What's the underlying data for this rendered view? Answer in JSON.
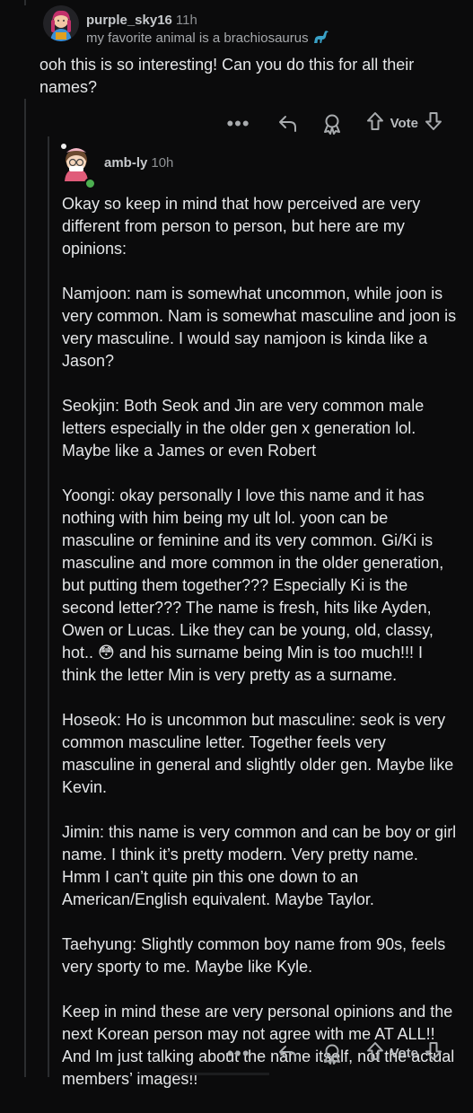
{
  "parent": {
    "username": "purple_sky16",
    "time": "11h",
    "flair": "my favorite animal is a brachiosaurus",
    "body": "ooh this is so interesting! Can you do this for all their names?"
  },
  "actions": {
    "vote_label": "Vote"
  },
  "reply": {
    "username": "amb-ly",
    "time": "10h",
    "paragraphs": [
      "Okay so keep in mind that how perceived are very different from person to person, but here are my opinions:",
      "Namjoon: nam is somewhat uncommon, while joon is very common. Nam is somewhat masculine and joon is very masculine. I would say namjoon is kinda like a Jason?",
      "Seokjin: Both Seok and Jin are very common male letters especially in the older gen x generation lol. Maybe like a James or even Robert",
      "Yoongi: okay personally I love this name and it has nothing with him being my ult lol. yoon can be masculine or feminine and its very common. Gi/Ki is masculine and more common in the older generation, but putting them together??? Especially Ki is the second letter??? The name is fresh, hits like Ayden, Owen or Lucas. Like they can be young, old, classy, hot.. 😳 and his surname being Min is too much!!! I think the letter Min is very pretty as a surname.",
      "Hoseok: Ho is uncommon but masculine: seok is very common masculine letter. Together feels very masculine in general and slightly older gen. Maybe like Kevin.",
      "Jimin: this name is very common and can be boy or girl name. I think it’s pretty modern. Very pretty name. Hmm I can’t quite pin this one down to an American/English equivalent. Maybe Taylor.",
      "Taehyung: Slightly common boy name from 90s, feels very sporty to me. Maybe like Kyle.",
      "Keep in mind these are very personal opinions and the next Korean person may not agree with me AT ALL!! And Im just talking about the name itself, not the actual members’ images!!"
    ]
  },
  "icons": {
    "more": "more-options-icon",
    "reply": "reply-arrow-icon",
    "award": "award-icon",
    "upvote": "upvote-arrow-icon",
    "downvote": "downvote-arrow-icon",
    "dino": "dinosaur-icon"
  },
  "colors": {
    "background": "#0b0b0c",
    "text": "#e4e6e8",
    "muted": "#8e9194",
    "online": "#4caf50"
  }
}
